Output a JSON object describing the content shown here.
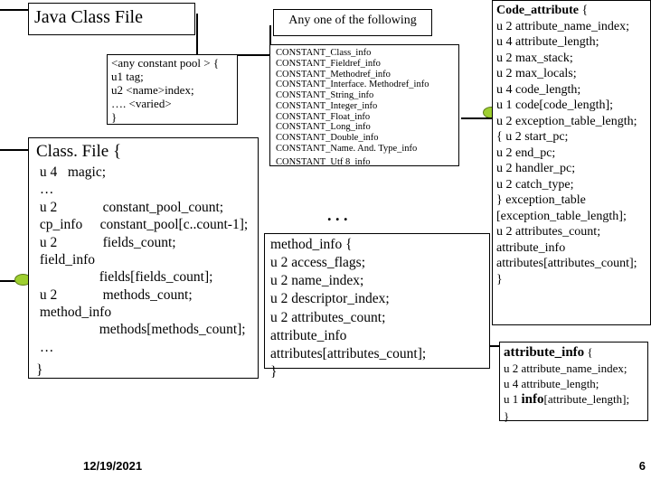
{
  "title": "Java Class File",
  "constant_pool": {
    "l1": "<any constant pool > {",
    "l2": "  u1  tag;",
    "l3": "  u2  <name>index;",
    "l4": "  ….  <varied>",
    "l5": "}"
  },
  "classfile": {
    "head": "Class. File {",
    "r1": " u 4   magic;",
    "r2": " …",
    "r3": " u 2             constant_pool_count;",
    "r4": " cp_info     constant_pool[c..count-1];",
    "r5": " u 2             fields_count;",
    "r6": " field_info",
    "r7": "                  fields[fields_count];",
    "r8": " u 2             methods_count;",
    "r9": " method_info",
    "r10": "                  methods[methods_count];",
    "r11": " …",
    "r12": "}"
  },
  "any_label": "Any one of the following",
  "constants": {
    "c1": "CONSTANT_Class_info",
    "c2": "CONSTANT_Fieldref_info",
    "c3": "CONSTANT_Methodref_info",
    "c4": "CONSTANT_Interface. Methodref_info",
    "c5": "CONSTANT_String_info",
    "c6": "CONSTANT_Integer_info",
    "c7": "CONSTANT_Float_info",
    "c8": "CONSTANT_Long_info",
    "c9": "CONSTANT_Double_info",
    "c10": "CONSTANT_Name. And. Type_info",
    "c11": "CONSTANT_Utf 8_info"
  },
  "dots": ". . .",
  "method_info": {
    "m1": "method_info {",
    "m2": "  u 2   access_flags;",
    "m3": "  u 2   name_index;",
    "m4": "  u 2   descriptor_index;",
    "m5": "  u 2   attributes_count;",
    "m6": "  attribute_info",
    "m7": "         attributes[attributes_count];",
    "m8": "}"
  },
  "code_attr": {
    "h": "Code_attribute",
    "l1": "  u 2 attribute_name_index;",
    "l2": "  u 4 attribute_length;",
    "l3": "  u 2 max_stack;",
    "l4": "  u 2 max_locals;",
    "l5": "  u 4 code_length;",
    "l6": "  u 1 code[code_length];",
    "l7": "  u 2 exception_table_length;",
    "l8": "  {  u 2 start_pc;",
    "l9": "     u 2 end_pc;",
    "l10": "     u 2 handler_pc;",
    "l11": "     u 2 catch_type;",
    "l12": "  } exception_table",
    "l13": "       [exception_table_length];",
    "l14": "  u 2 attributes_count;",
    "l15": "  attribute_info",
    "l16": "       attributes[attributes_count];",
    "l17": "}"
  },
  "attr_info": {
    "h": "attribute_info",
    "l1": "  u 2 attribute_name_index;",
    "l2": "  u 4 attribute_length;",
    "l3a": "  u 1 ",
    "l3b": "info",
    "l3c": "[attribute_length];",
    "l4": "}"
  },
  "date": "12/19/2021",
  "pagenum": "6"
}
